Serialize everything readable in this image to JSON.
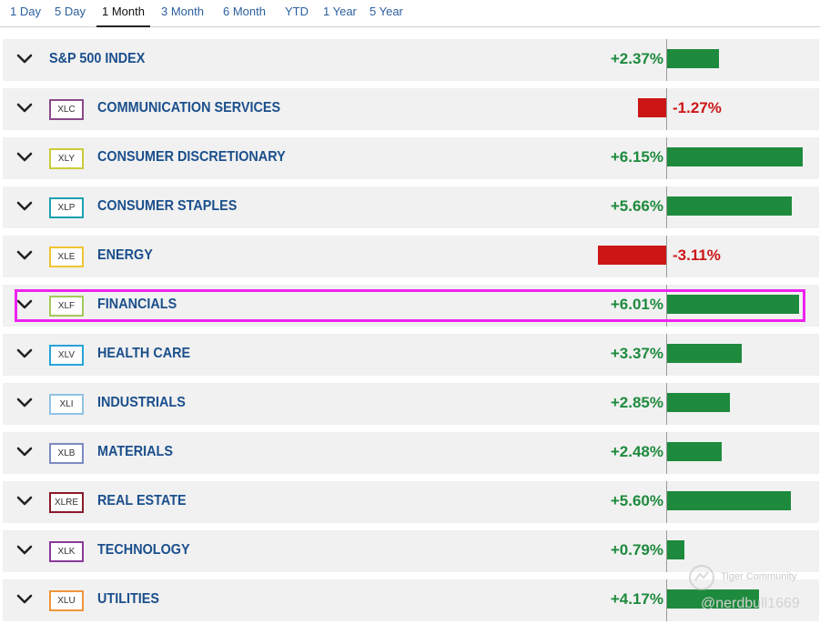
{
  "tabs": [
    {
      "label": "1 Day"
    },
    {
      "label": "5 Day"
    },
    {
      "label": "1 Month"
    },
    {
      "label": "3 Month"
    },
    {
      "label": "6 Month"
    },
    {
      "label": "YTD"
    },
    {
      "label": "1 Year"
    },
    {
      "label": "5 Year"
    }
  ],
  "active_tab": "1 Month",
  "rows": [
    {
      "etf": "",
      "name": "S&P 500 INDEX",
      "change": "+2.37%",
      "value": 2.37,
      "color": ""
    },
    {
      "etf": "XLC",
      "name": "COMMUNICATION SERVICES",
      "change": "-1.27%",
      "value": -1.27,
      "color": "#8a4a8a"
    },
    {
      "etf": "XLY",
      "name": "CONSUMER DISCRETIONARY",
      "change": "+6.15%",
      "value": 6.15,
      "color": "#c9cc3a"
    },
    {
      "etf": "XLP",
      "name": "CONSUMER STAPLES",
      "change": "+5.66%",
      "value": 5.66,
      "color": "#1aa0b0"
    },
    {
      "etf": "XLE",
      "name": "ENERGY",
      "change": "-3.11%",
      "value": -3.11,
      "color": "#f0c430"
    },
    {
      "etf": "XLF",
      "name": "FINANCIALS",
      "change": "+6.01%",
      "value": 6.01,
      "color": "#a5c85a"
    },
    {
      "etf": "XLV",
      "name": "HEALTH CARE",
      "change": "+3.37%",
      "value": 3.37,
      "color": "#27a3d8"
    },
    {
      "etf": "XLI",
      "name": "INDUSTRIALS",
      "change": "+2.85%",
      "value": 2.85,
      "color": "#8fc3e3"
    },
    {
      "etf": "XLB",
      "name": "MATERIALS",
      "change": "+2.48%",
      "value": 2.48,
      "color": "#7d8ac0"
    },
    {
      "etf": "XLRE",
      "name": "REAL ESTATE",
      "change": "+5.60%",
      "value": 5.6,
      "color": "#8a1a2a"
    },
    {
      "etf": "XLK",
      "name": "TECHNOLOGY",
      "change": "+0.79%",
      "value": 0.79,
      "color": "#8a3a9a"
    },
    {
      "etf": "XLU",
      "name": "UTILITIES",
      "change": "+4.17%",
      "value": 4.17,
      "color": "#f0953a"
    }
  ],
  "highlighted_row": "FINANCIALS",
  "colors": {
    "positive": "#1e8a3d",
    "negative": "#cc1616",
    "highlight": "#ee22ee",
    "name": "#1b4f8c"
  },
  "watermark": {
    "brand": "Tiger Community",
    "handle": "@nerdbull1669",
    "icon": "tiger-logo-icon"
  }
}
